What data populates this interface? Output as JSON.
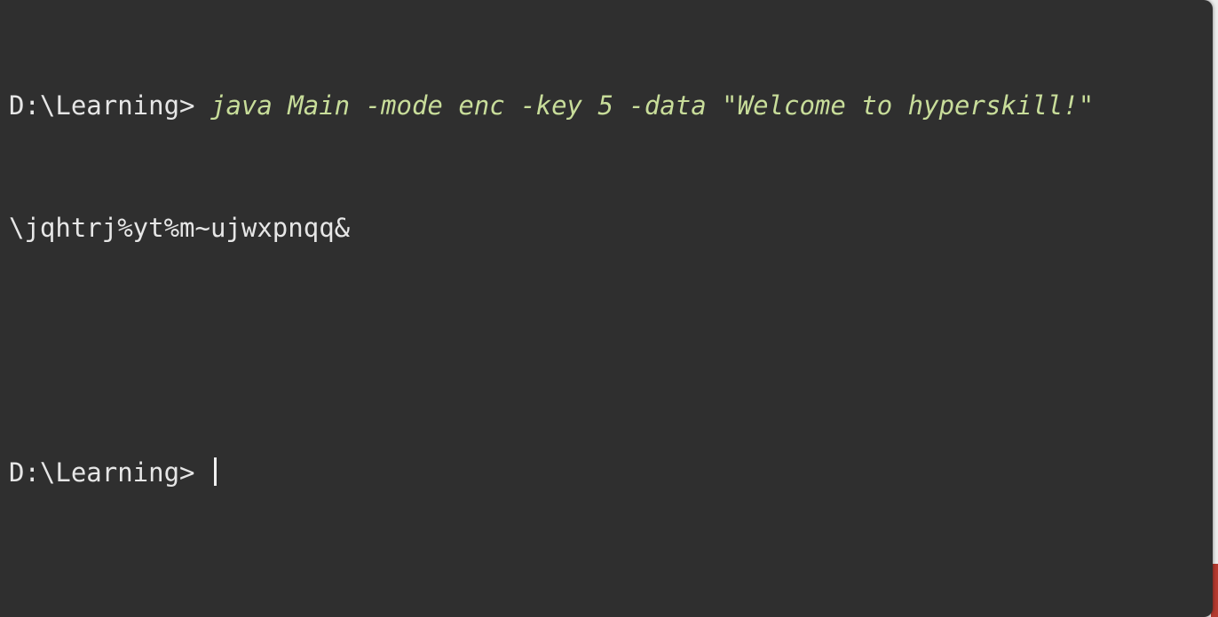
{
  "terminal": {
    "lines": [
      {
        "prompt": "D:\\Learning>",
        "command": "java Main -mode enc -key 5 -data \"Welcome to hyperskill!\""
      },
      {
        "output": "\\jqhtrj%yt%m~ujwxpnqq&"
      },
      {
        "output": ""
      },
      {
        "prompt": "D:\\Learning>",
        "command": ""
      }
    ]
  }
}
